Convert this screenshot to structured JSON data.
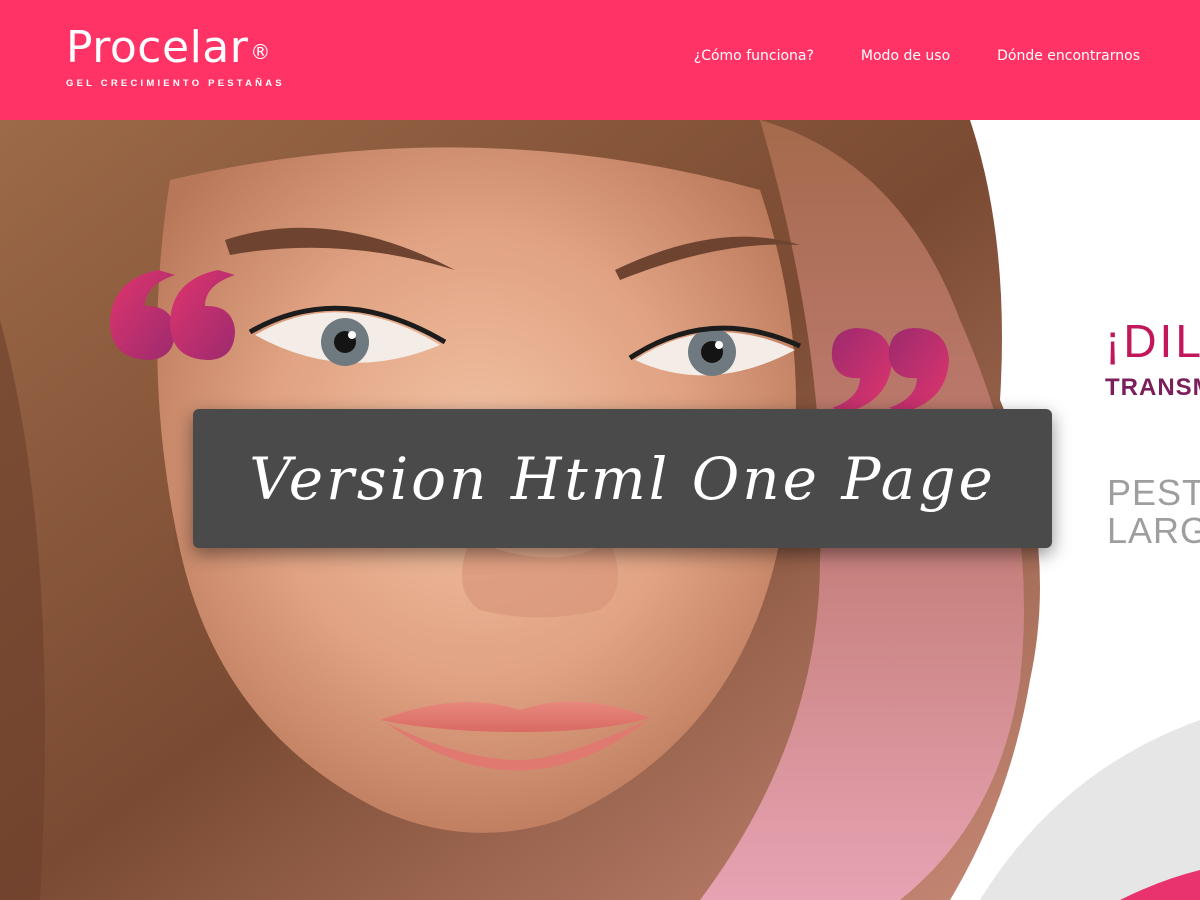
{
  "header": {
    "logo_name": "Procelar",
    "logo_reg": "®",
    "logo_tagline": "GEL CRECIMIENTO PESTAÑAS",
    "nav": [
      {
        "label": "¿Cómo funciona?"
      },
      {
        "label": "Modo de uso"
      },
      {
        "label": "Dónde encontrarnos"
      }
    ]
  },
  "hero": {
    "headline_1": "¡DIL",
    "headline_2": "TRANSM",
    "sub_1": "PESTA",
    "sub_2": "LARGA"
  },
  "banner": {
    "text": "Version Html One Page"
  },
  "colors": {
    "brand_pink": "#ff3366",
    "headline": "#c2185b",
    "headline_dark": "#7b1f5a",
    "banner_bg": "#4a4a4a",
    "sub_text": "#9e9e9e"
  }
}
